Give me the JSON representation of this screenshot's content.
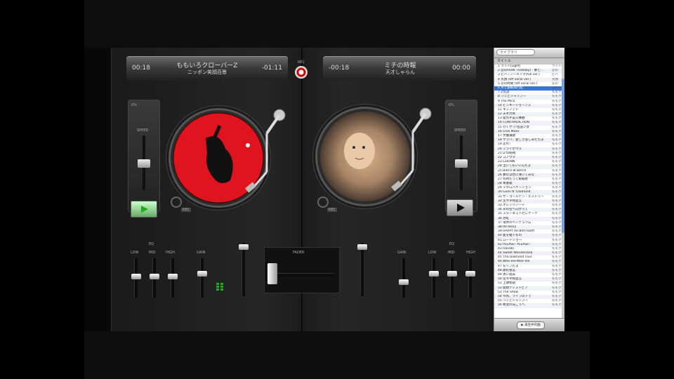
{
  "deckA": {
    "elapsed": "00:18",
    "title": "ももいろクローバーZ",
    "artist": "ニッポン笑顔百景",
    "remaining": "-01:11",
    "rec_label": "REC"
  },
  "deckB": {
    "elapsed": "-00:18",
    "title": "ミチの時報",
    "artist": "天才しゃらん",
    "remaining": "00:00",
    "rec_label": "REC"
  },
  "record": {
    "label": "REC"
  },
  "pitchA": {
    "label": "SPEED",
    "value": "0%"
  },
  "pitchB": {
    "label": "SPEED",
    "value": "0%"
  },
  "mixer": {
    "eq_label": "EQ",
    "low": "LOW",
    "mid": "MID",
    "high": "HIGH",
    "gain": "GAIN",
    "crossfader_label": "FADER"
  },
  "library": {
    "search_placeholder": "ライブラリ",
    "column": "タイトル",
    "footer_button": "▶ 再生中の曲",
    "rows": [
      {
        "n": "1 ライト(Light)",
        "a": "ライト"
      },
      {
        "n": "2 恋のHOW TO(Baby) - 夢と… ",
        "a": "恋の"
      },
      {
        "n": "3 ビバ☆ノーメイク(full ver.)",
        "a": "ビバ"
      },
      {
        "n": "4 笑顔 (off vocal ver.)",
        "a": "笑顔"
      },
      {
        "n": "5 恋の時間 (off vocal ver.)",
        "a": "恋の"
      },
      {
        "n": "6 月と銀紙飛行船",
        "a": "ももクロ"
      },
      {
        "n": "7 Z伝説",
        "a": "ももクロ"
      },
      {
        "n": "8 ワニとシャンプー",
        "a": "ももクロ"
      },
      {
        "n": "9 The Mico",
        "a": "ももクロ"
      },
      {
        "n": "10 ピンキージョーンズ",
        "a": "ももクロ"
      },
      {
        "n": "11 キミノアト",
        "a": "ももクロ"
      },
      {
        "n": "12 天手力男",
        "a": "ももクロ"
      },
      {
        "n": "13 猛烈宇宙交響曲",
        "a": "ももクロ"
      },
      {
        "n": "14 CONTRADICTION",
        "a": "ももクロ"
      },
      {
        "n": "15 行くぜっ!怪盗少女",
        "a": "ももクロ"
      },
      {
        "n": "16 Chai Maxx",
        "a": "ももクロ"
      },
      {
        "n": "17 労働讃歌",
        "a": "ももクロ"
      },
      {
        "n": "18 サラバ、愛しき悲しみたちよ",
        "a": "ももクロ"
      },
      {
        "n": "19 走れ!",
        "a": "ももクロ"
      },
      {
        "n": "20 ミライボウル",
        "a": "ももクロ"
      },
      {
        "n": "21 D'の純情",
        "a": "ももクロ"
      },
      {
        "n": "22 コノウタ",
        "a": "ももクロ"
      },
      {
        "n": "23 GOUNN",
        "a": "ももクロ"
      },
      {
        "n": "24 泣いてもいいんだよ",
        "a": "ももクロ"
      },
      {
        "n": "25 BIRTH Ø BIRTH",
        "a": "ももクロ"
      },
      {
        "n": "26 夢の浮世に咲いてみな",
        "a": "ももクロ"
      },
      {
        "n": "27 何時だって挑戦者",
        "a": "ももクロ"
      },
      {
        "n": "28 青春賦",
        "a": "ももクロ"
      },
      {
        "n": "29 マホロバケーション",
        "a": "ももクロ"
      },
      {
        "n": "30 Guns N' Diamond",
        "a": "ももクロ"
      },
      {
        "n": "31 ザ・ゴールデン・ヒストリー",
        "a": "ももクロ"
      },
      {
        "n": "32 堂々平和宣言",
        "a": "ももクロ"
      },
      {
        "n": "33 オレンジノート",
        "a": "ももクロ"
      },
      {
        "n": "34 あの空へ向かって",
        "a": "ももクロ"
      },
      {
        "n": "35 スターダストセレナーデ",
        "a": "ももクロ"
      },
      {
        "n": "36 月虹",
        "a": "ももクロ"
      },
      {
        "n": "37 境界のペンデュラム",
        "a": "ももクロ"
      },
      {
        "n": "38 Re:Story",
        "a": "ももクロ"
      },
      {
        "n": "39 HAPPY Re:BIRTHDAY",
        "a": "ももクロ"
      },
      {
        "n": "40 愛を継ぐもの",
        "a": "ももクロ"
      },
      {
        "n": "41 ロードショー",
        "a": "ももクロ"
      },
      {
        "n": "42 PLEASE! PLEASE!",
        "a": "ももクロ"
      },
      {
        "n": "43 Hanabi",
        "a": "ももクロ"
      },
      {
        "n": "44 Sweet Wonderland",
        "a": "ももクロ"
      },
      {
        "n": "45 The Diamond Four",
        "a": "ももクロ"
      },
      {
        "n": "46 Wee-Tee-Wee-Tee",
        "a": "ももクロ"
      },
      {
        "n": "47 もリフだよ",
        "a": "ももクロ"
      },
      {
        "n": "48 鋼の意志",
        "a": "ももクロ"
      },
      {
        "n": "49 黒い週末",
        "a": "ももクロ"
      },
      {
        "n": "50 堂々平和宣言",
        "a": "ももクロ"
      },
      {
        "n": "51 上球物語",
        "a": "ももクロ"
      },
      {
        "n": "52 仮想ディストピア",
        "a": "ももクロ"
      },
      {
        "n": "53 The Show",
        "a": "ももクロ"
      },
      {
        "n": "54 今宵、ライブの下で",
        "a": "ももクロ"
      },
      {
        "n": "55 ワニとシャンプー",
        "a": "ももクロ"
      },
      {
        "n": "56 希望の向こうへ",
        "a": "ももクロ"
      }
    ]
  }
}
